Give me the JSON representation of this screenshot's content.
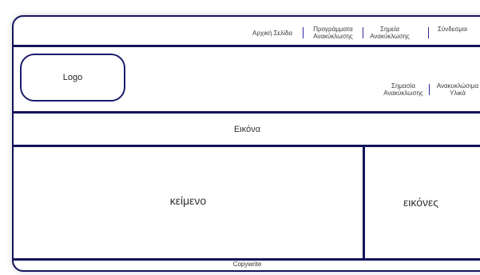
{
  "nav": {
    "home": "Αρχική Σελίδα",
    "programs_line1": "Προγράμματα",
    "programs_line2": "Ανακύκλωσης",
    "points_line1": "Σημεία",
    "points_line2": "Ανακύκλωσης",
    "links": "Σύνδεσμοι"
  },
  "logo_label": "Logo",
  "subnav": {
    "signs_line1": "Σημασία",
    "signs_line2": "Ανακύκλωσης",
    "materials_line1": "Ανακυκλώσιμα",
    "materials_line2": "Υλικά"
  },
  "banner_label": "Εικόνα",
  "content_label": "κείμενο",
  "images_label": "εικόνες",
  "footer_label": "Copywrite",
  "colors": {
    "border": "#14145a",
    "separator": "#2a2aa0"
  }
}
